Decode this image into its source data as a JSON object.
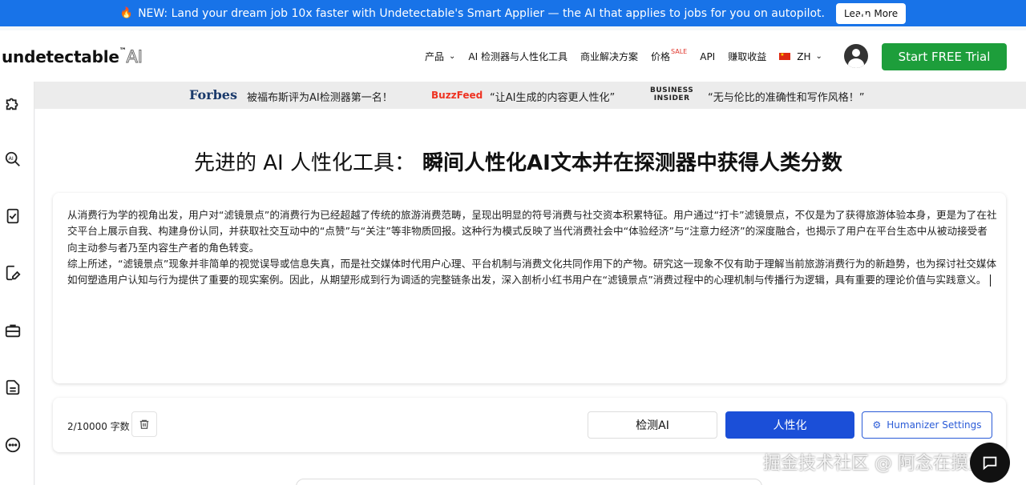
{
  "banner": {
    "text": "NEW: Land your dream job 10x faster with Undetectable's Smart Applier — the AI that applies to jobs for you on autopilot.",
    "learn_more": "Learn More",
    "close": "✕"
  },
  "nav": {
    "logo": "undetectable",
    "logo_tm": "™",
    "logo_ai": "AI",
    "items": [
      {
        "label": "产品"
      },
      {
        "label": "AI 检测器与人性化工具"
      },
      {
        "label": "商业解决方案"
      },
      {
        "label": "价格",
        "badge": "SALE"
      },
      {
        "label": "API"
      },
      {
        "label": "赚取收益"
      },
      {
        "label": "ZH"
      }
    ],
    "cta": "Start FREE Trial"
  },
  "sidebar": {
    "icons": [
      "puzzle-icon",
      "ai-search-icon",
      "checklist-icon",
      "edit-document-icon",
      "briefcase-icon",
      "document-icon",
      "more-icon"
    ]
  },
  "press": {
    "forbes_logo": "Forbes",
    "forbes_quote": "被福布斯评为AI检测器第一名！",
    "buzzfeed_logo": "BuzzFeed",
    "buzzfeed_quote": "“让AI生成的内容更人性化”",
    "bi_logo_line1": "BUSINESS",
    "bi_logo_line2": "INSIDER",
    "bi_quote": "“无与伦比的准确性和写作风格！”"
  },
  "main": {
    "heading_light": "先进的 AI 人性化工具：",
    "heading_bold": "瞬间人性化AI文本并在探测器中获得人类分数",
    "editor": {
      "paragraph1": "从消费行为学的视角出发，用户对“滤镜景点”的消费行为已经超越了传统的旅游消费范畴，呈现出明显的符号消费与社交资本积累特征。用户通过“打卡”滤镜景点，不仅是为了获得旅游体验本身，更是为了在社交平台上展示自我、构建身份认同，并获取社交互动中的“点赞”与“关注”等非物质回报。这种行为模式反映了当代消费社会中“体验经济”与“注意力经济”的深度融合，也揭示了用户在平台生态中从被动接受者向主动参与者乃至内容生产者的角色转变。",
      "paragraph2": "综上所述，“滤镜景点”现象并非简单的视觉误导或信息失真，而是社交媒体时代用户心理、平台机制与消费文化共同作用下的产物。研究这一现象不仅有助于理解当前旅游消费行为的新趋势，也为探讨社交媒体如何塑造用户认知与行为提供了重要的现实案例。因此，从期望形成到行为调适的完整链条出发，深入剖析小红书用户在“滤镜景点”消费过程中的心理机制与传播行为逻辑，具有重要的理论价值与实践意义。"
    },
    "toolbar": {
      "count": "2/10000 字数",
      "detect": "检测AI",
      "humanize": "人性化",
      "settings": "Humanizer Settings"
    }
  },
  "watermark": "掘金技术社区 @ 阿念在摸鱼",
  "colors": {
    "banner_bg": "#1873e8",
    "cta_bg": "#1d9e3b",
    "humanize_bg": "#1b4fd8"
  }
}
